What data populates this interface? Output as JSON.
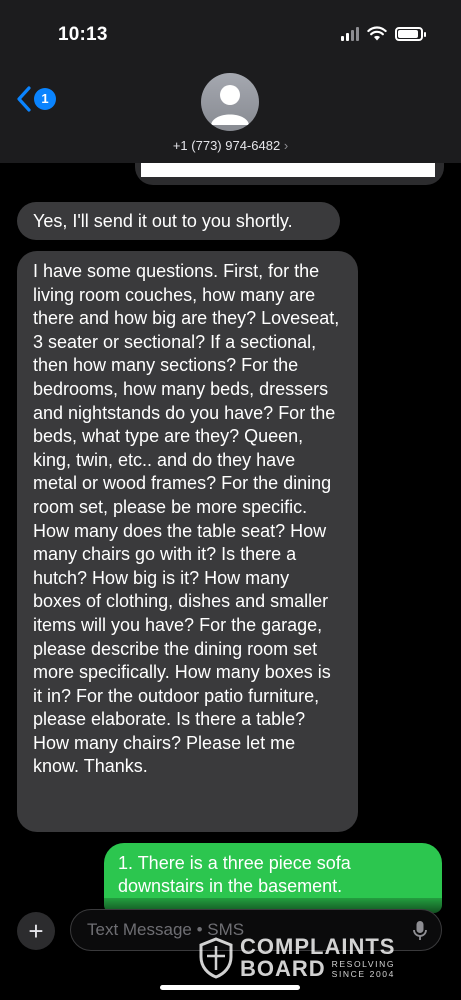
{
  "status_bar": {
    "time": "10:13"
  },
  "header": {
    "back_badge": "1",
    "contact_number": "+1 (773) 974-6482",
    "contact_chevron": "›"
  },
  "messages": [
    {
      "direction": "incoming",
      "text": "Yes, I'll send it out to you shortly."
    },
    {
      "direction": "incoming",
      "text": "I have some questions. First, for the living room couches, how many are there and how big are they? Loveseat, 3 seater or sectional? If a sectional, then how many sections? For the bedrooms, how many beds, dressers and nightstands do you have? For the beds, what type are they? Queen, king, twin, etc.. and do they have metal or wood frames? For the dining room set, please be more specific. How many does the table seat? How many chairs go with it? Is there a hutch? How big is it? How many boxes of clothing, dishes and smaller items will you have? For the garage, please describe the dining room set more specifically. How many boxes is it in? For the outdoor patio furniture, please elaborate. Is there a table? How many chairs? Please let me know. Thanks."
    },
    {
      "direction": "outgoing",
      "text": "1. There is a three piece sofa downstairs in the basement."
    }
  ],
  "composer": {
    "plus_label": "+",
    "placeholder": "Text Message • SMS"
  },
  "watermark": {
    "line1": "COMPLAINTS",
    "line2": "BOARD",
    "tag1": "RESOLVING",
    "tag2": "SINCE 2004"
  },
  "colors": {
    "incoming_bubble": "#3a3a3c",
    "outgoing_bubble": "#2cc64f",
    "accent": "#0a84ff"
  }
}
